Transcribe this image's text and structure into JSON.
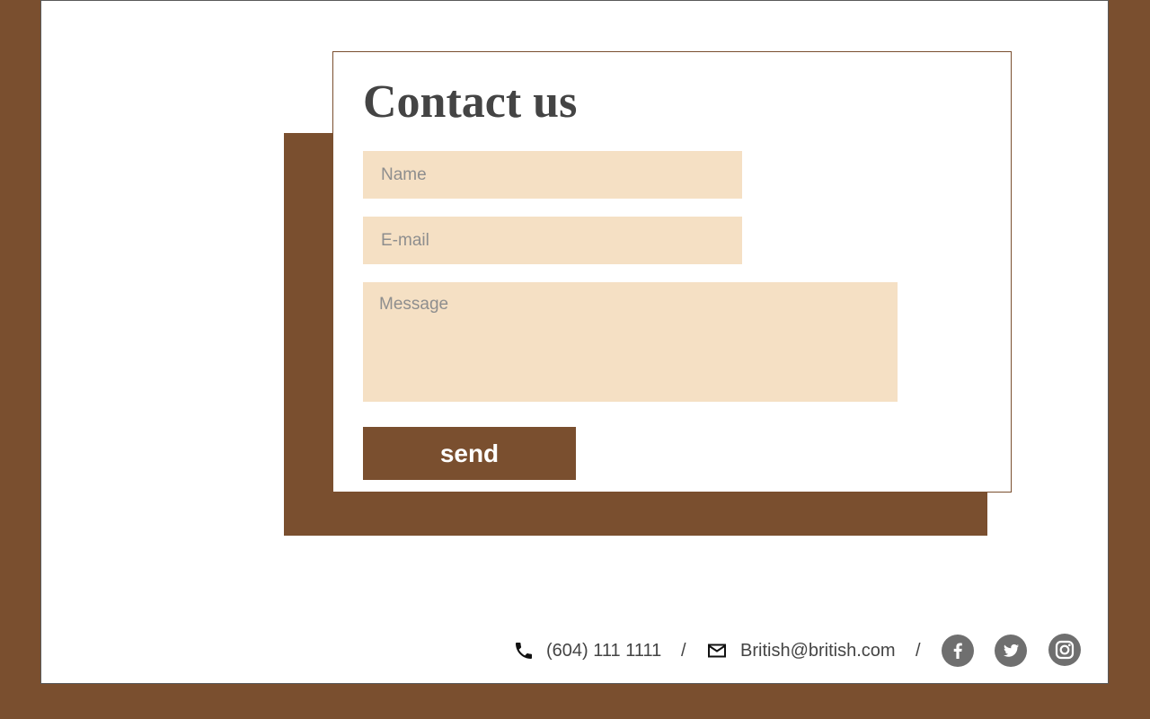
{
  "contact": {
    "title": "Contact us",
    "name_placeholder": "Name",
    "email_placeholder": "E-mail",
    "message_placeholder": "Message",
    "send_label": "send"
  },
  "footer": {
    "phone": "(604) 111 1111",
    "separator": "/",
    "email": "British@british.com",
    "icons": [
      "phone-icon",
      "mail-icon",
      "facebook-icon",
      "twitter-icon",
      "instagram-icon"
    ]
  },
  "colors": {
    "brand_brown": "#7a4f2f",
    "field_background": "#f5e0c4",
    "text": "#444444",
    "social_icon": "#6f6f6f"
  }
}
